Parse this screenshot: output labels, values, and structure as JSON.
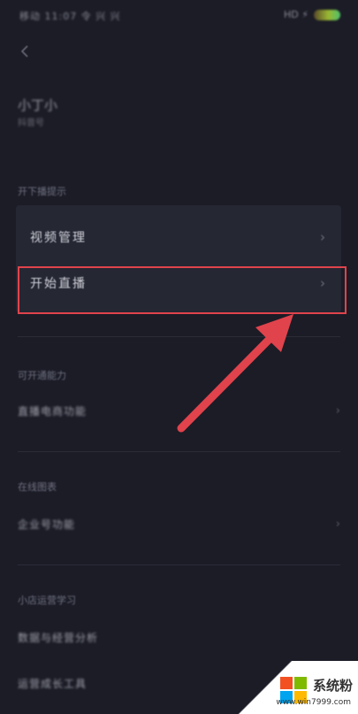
{
  "status_bar": {
    "left_text": "移动 11:07 令 兴 兴",
    "right_text": "HD ⚡"
  },
  "profile": {
    "name": "小丁小",
    "sub": "抖音号"
  },
  "section1": {
    "title": "开下播提示",
    "items": [
      {
        "label": "视频管理"
      },
      {
        "label": "开始直播"
      }
    ]
  },
  "section2": {
    "title": "可开通能力",
    "items": [
      {
        "label": "直播电商功能"
      }
    ]
  },
  "section3": {
    "title": "在线图表",
    "items": [
      {
        "label": "企业号功能"
      }
    ]
  },
  "section4": {
    "title": "小店运营学习",
    "items": [
      {
        "label": "数据与经营分析"
      },
      {
        "label": "运营成长工具"
      }
    ]
  },
  "watermark": {
    "brand": "系统粉",
    "url": "www.win7999.com",
    "colors": [
      "#f25022",
      "#7fba00",
      "#00a4ef",
      "#ffb900"
    ]
  },
  "accent": {
    "highlight": "#e0434c"
  }
}
